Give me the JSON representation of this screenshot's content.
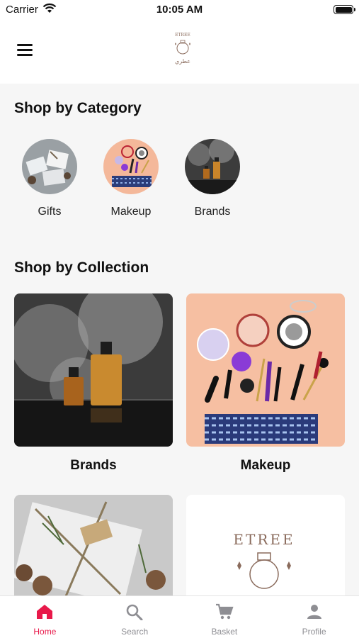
{
  "status_bar": {
    "carrier": "Carrier",
    "time": "10:05 AM"
  },
  "header": {
    "logo_text_top": "ETREE",
    "logo_text_bottom": "عطري"
  },
  "sections": {
    "category_title": "Shop by Category",
    "collection_title": "Shop by Collection"
  },
  "categories": [
    {
      "label": "Gifts"
    },
    {
      "label": "Makeup"
    },
    {
      "label": "Brands"
    }
  ],
  "collections": [
    {
      "label": "Brands"
    },
    {
      "label": "Makeup"
    }
  ],
  "tabs": [
    {
      "label": "Home",
      "icon": "home-icon",
      "active": true
    },
    {
      "label": "Search",
      "icon": "search-icon"
    },
    {
      "label": "Basket",
      "icon": "cart-icon"
    },
    {
      "label": "Profile",
      "icon": "person-icon"
    }
  ],
  "colors": {
    "accent": "#e8194a",
    "inactive": "#8e8e93"
  }
}
